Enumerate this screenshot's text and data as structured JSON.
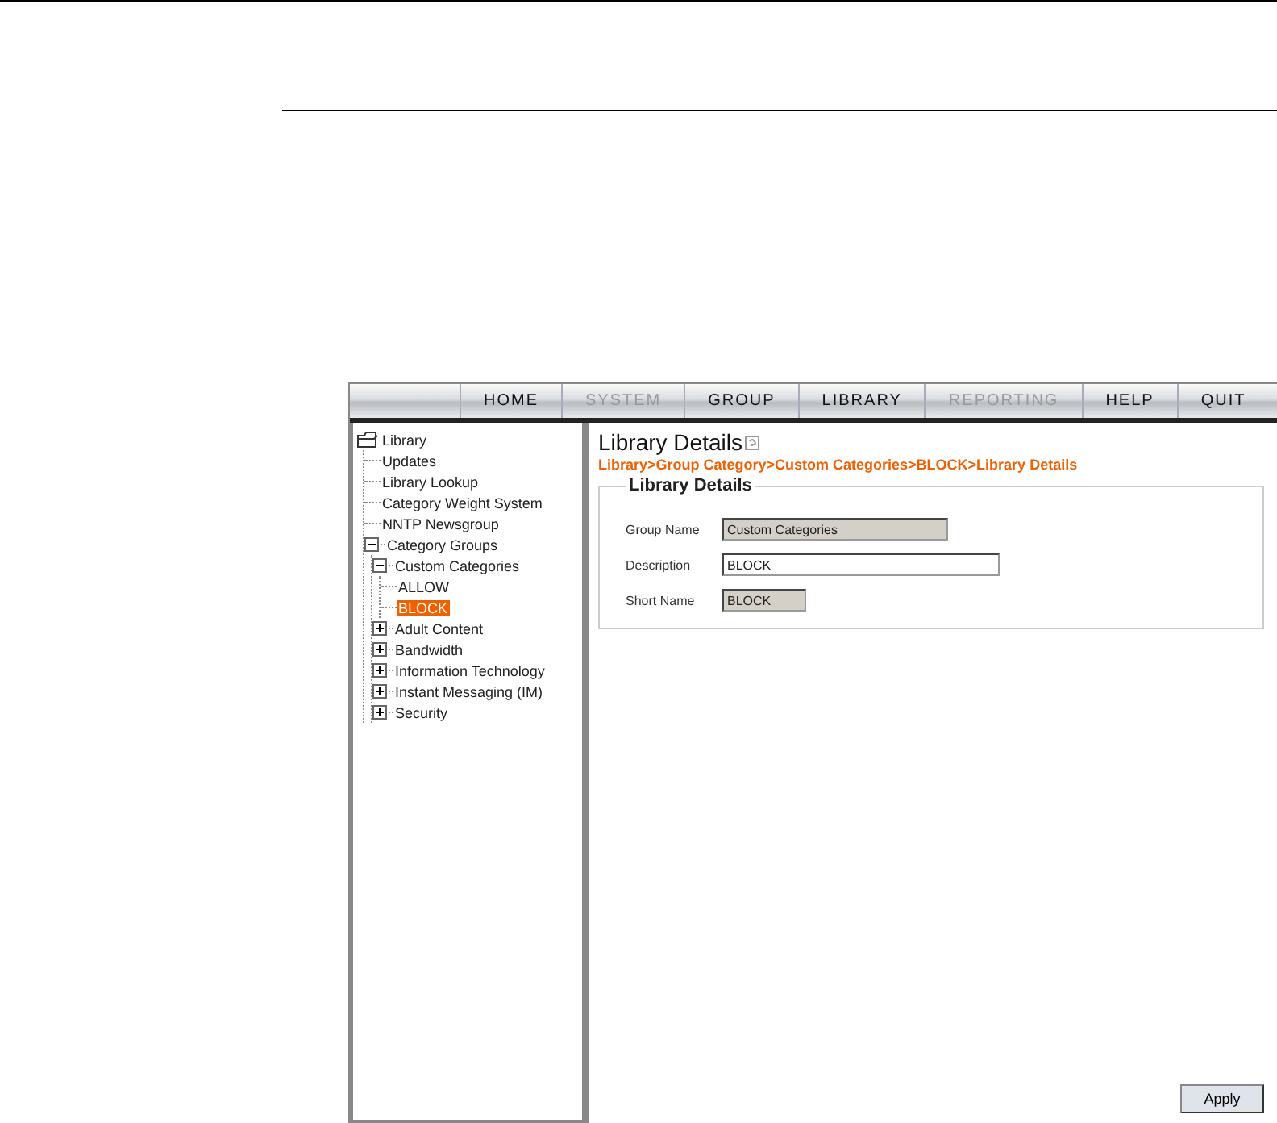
{
  "nav": [
    {
      "label": "HOME",
      "disabled": false
    },
    {
      "label": "SYSTEM",
      "disabled": true
    },
    {
      "label": "GROUP",
      "disabled": false
    },
    {
      "label": "LIBRARY",
      "disabled": false
    },
    {
      "label": "REPORTING",
      "disabled": true
    },
    {
      "label": "HELP",
      "disabled": false
    },
    {
      "label": "QUIT",
      "disabled": false
    }
  ],
  "tree": {
    "label": "Library",
    "selected": false,
    "children": [
      {
        "label": "Updates",
        "selected": false
      },
      {
        "label": "Library Lookup",
        "selected": false
      },
      {
        "label": "Category Weight System",
        "selected": false
      },
      {
        "label": "NNTP Newsgroup",
        "selected": false
      },
      {
        "label": "Category Groups",
        "selected": false,
        "expanded": true,
        "children": [
          {
            "label": "Custom Categories",
            "selected": false,
            "expanded": true,
            "children": [
              {
                "label": "ALLOW",
                "selected": false
              },
              {
                "label": "BLOCK",
                "selected": true
              }
            ]
          },
          {
            "label": "Adult Content",
            "selected": false,
            "expanded": false
          },
          {
            "label": "Bandwidth",
            "selected": false,
            "expanded": false
          },
          {
            "label": "Information Technology",
            "selected": false,
            "expanded": false
          },
          {
            "label": "Instant Messaging (IM)",
            "selected": false,
            "expanded": false
          },
          {
            "label": "Security",
            "selected": false,
            "expanded": false
          }
        ]
      }
    ]
  },
  "details": {
    "title": "Library Details",
    "breadcrumb": "Library>Group Category>Custom Categories>BLOCK>Library Details",
    "section": "Library Details",
    "fields": [
      {
        "label": "Group Name",
        "value": "Custom Categories",
        "disabled": true
      },
      {
        "label": "Description",
        "value": "BLOCK",
        "disabled": false
      },
      {
        "label": "Short Name",
        "value": "BLOCK",
        "disabled": true
      }
    ]
  },
  "buttons": [
    "Apply"
  ]
}
